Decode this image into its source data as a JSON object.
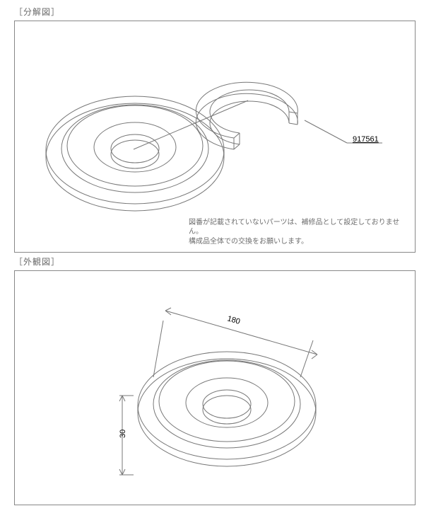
{
  "sections": {
    "exploded": {
      "label": "［分解図］"
    },
    "exterior": {
      "label": "［外観図］"
    }
  },
  "callouts": {
    "ring_part_no": "917561"
  },
  "notes": {
    "line1": "図番が記載されていないパーツは、補修品として設定しておりません。",
    "line2": "構成品全体での交換をお願いします。"
  },
  "dimensions": {
    "diameter": "180",
    "thickness": "30"
  }
}
